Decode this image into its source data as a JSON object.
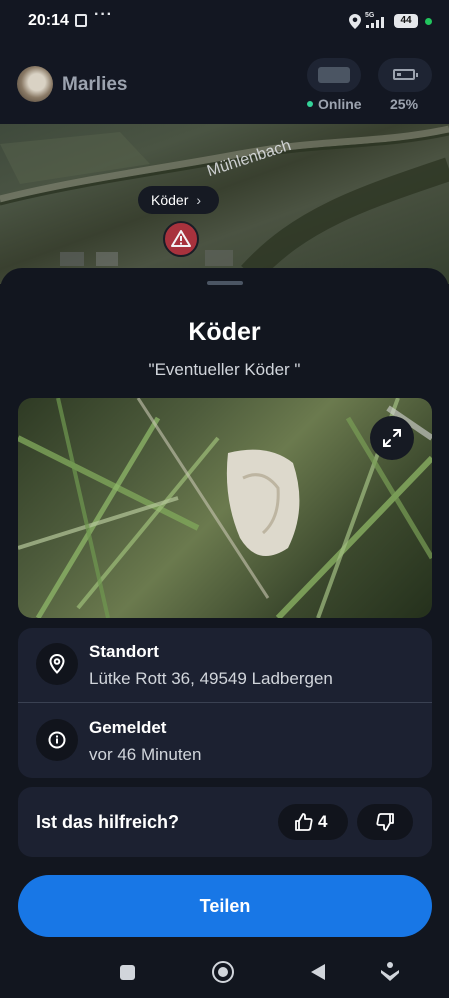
{
  "status_bar": {
    "time": "20:14",
    "more": "···",
    "network": "5G",
    "battery": "44",
    "icons": [
      "notification-icon",
      "location-icon",
      "signal-icon",
      "battery-icon",
      "active-dot-icon"
    ]
  },
  "header": {
    "pet_name": "Marlies",
    "connection_status": "Online",
    "battery_level": "25%",
    "online_color": "#34d399"
  },
  "map": {
    "place_label": "Mühlenbach",
    "tag_label": "Köder",
    "tag_chevron": "›",
    "marker_icon": "warning-icon",
    "marker_color": "#a8323d"
  },
  "report": {
    "title": "Köder",
    "quote": "\"Eventueller Köder \"",
    "photo_icon": "expand-icon",
    "details": [
      {
        "icon": "location-pin-icon",
        "label": "Standort",
        "value": "Lütke Rott 36, 49549 Ladbergen"
      },
      {
        "icon": "info-icon",
        "label": "Gemeldet",
        "value": "vor 46 Minuten"
      }
    ],
    "feedback": {
      "question": "Ist das hilfreich?",
      "upvotes": "4",
      "upvote_icon": "thumbs-up-icon",
      "downvote_icon": "thumbs-down-icon"
    },
    "share_label": "Teilen",
    "accent": "#1877e6"
  },
  "nav": [
    "recents-icon",
    "home-icon",
    "back-icon",
    "assistant-icon"
  ]
}
